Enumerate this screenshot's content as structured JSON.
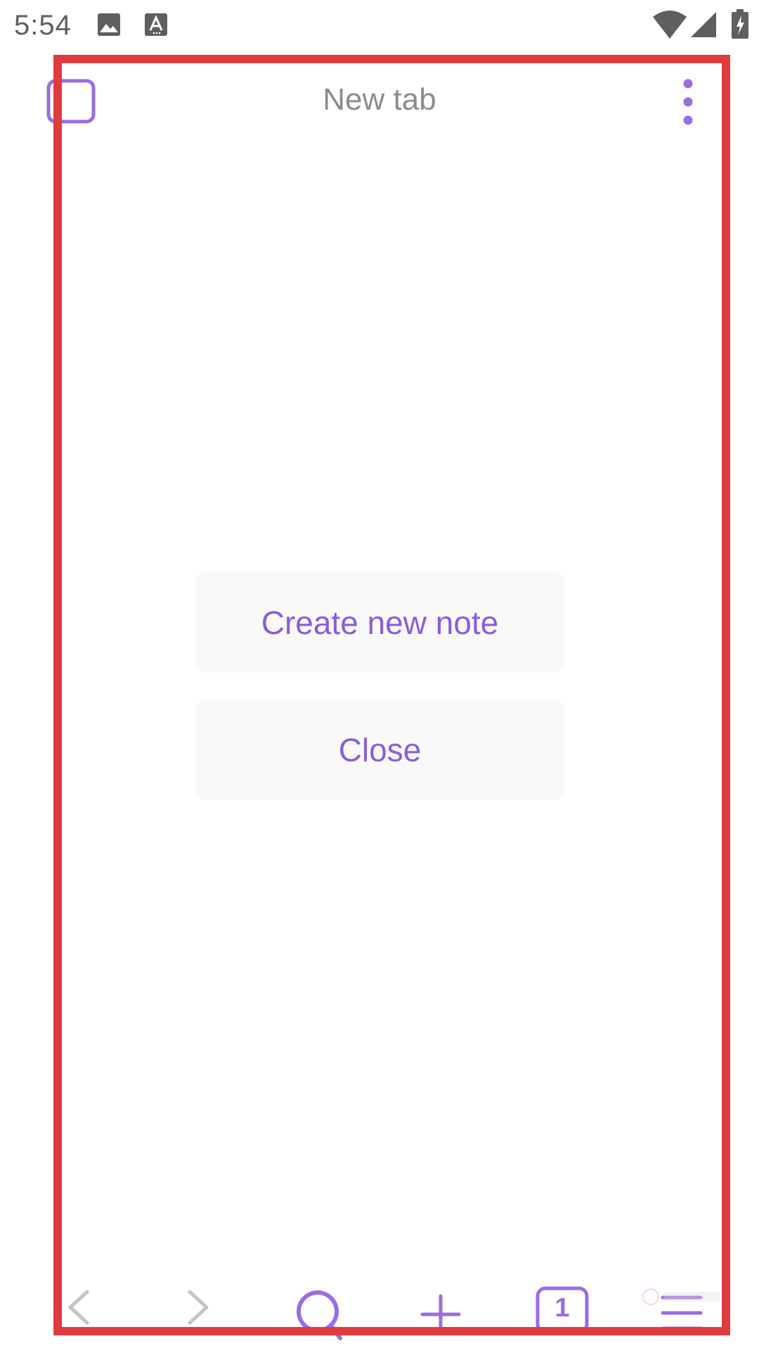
{
  "status_bar": {
    "time": "5:54",
    "icons": [
      "image-icon",
      "font-icon",
      "wifi-icon",
      "signal-icon",
      "battery-charging-icon"
    ]
  },
  "toolbar": {
    "title": "New tab",
    "left_icon": "square-icon",
    "right_icon": "more-vertical-icon"
  },
  "actions": {
    "create_note_label": "Create new note",
    "close_label": "Close"
  },
  "bottom_nav": {
    "items": [
      "back-icon",
      "forward-icon",
      "search-icon",
      "plus-icon",
      "tabs-icon",
      "menu-icon"
    ],
    "tab_count": "1"
  },
  "colors": {
    "accent": "#9a6ee3",
    "button_text": "#8a5ddb",
    "button_bg": "#f9f9f9",
    "title_text": "#8c8c8c",
    "disabled_icon": "#c4c4c4",
    "highlight_frame": "#e03c3f"
  }
}
